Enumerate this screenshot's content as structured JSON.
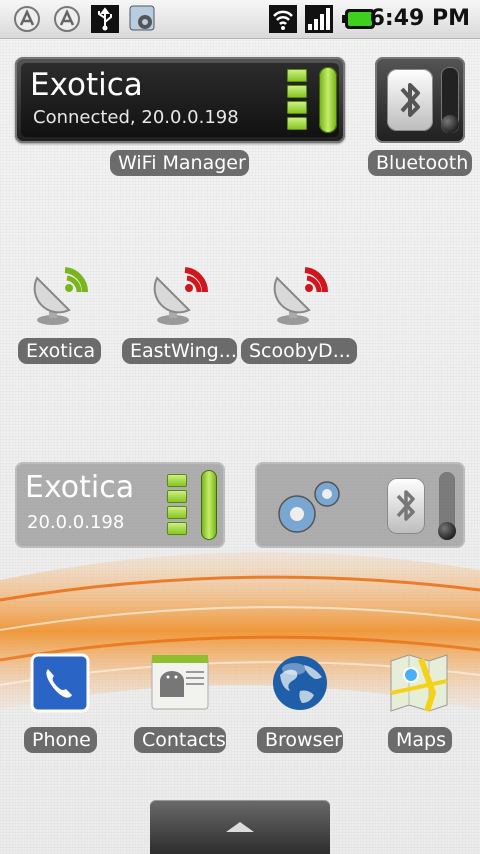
{
  "status_bar": {
    "time": "6:49 PM",
    "icons": [
      "android-notify-icon",
      "android-notify-icon",
      "usb-icon",
      "settings-notify-icon",
      "wifi-icon",
      "signal-icon",
      "battery-icon"
    ]
  },
  "wifi_widget_top": {
    "network": "Exotica",
    "status": "Connected, 20.0.0.198",
    "label": "WiFi Manager"
  },
  "bluetooth_widget": {
    "label": "Bluetooth"
  },
  "network_shortcuts": [
    {
      "label": "Exotica",
      "accent": "#7ab51d"
    },
    {
      "label": "EastWing...",
      "accent": "#d0161c"
    },
    {
      "label": "ScoobyD...",
      "accent": "#d0161c"
    }
  ],
  "wifi_widget_mid": {
    "network": "Exotica",
    "ip": "20.0.0.198"
  },
  "dock": [
    {
      "label": "Phone",
      "icon": "phone-icon"
    },
    {
      "label": "Contacts",
      "icon": "contacts-icon"
    },
    {
      "label": "Browser",
      "icon": "browser-globe-icon"
    },
    {
      "label": "Maps",
      "icon": "maps-icon"
    }
  ],
  "colors": {
    "accent_green": "#7ab51d",
    "accent_red": "#d0161c",
    "swoosh_orange": "#f08a1c"
  }
}
